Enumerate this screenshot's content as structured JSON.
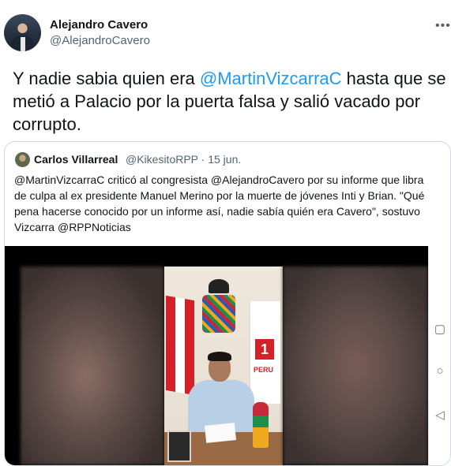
{
  "author": {
    "name": "Alejandro Cavero",
    "handle": "@AlejandroCavero"
  },
  "more_icon": "more-options-icon",
  "tweet": {
    "text_before": "Y nadie sabia quien era ",
    "mention": "@MartinVizcarraC",
    "text_after": " hasta que se metió a Palacio por la puerta falsa y salió vacado por corrupto."
  },
  "quote": {
    "name": "Carlos Villarreal",
    "handle_date": "@KikesitoRPP · 15 jun.",
    "text": "@MartinVizcarraC criticó al congresista @AlejandroCavero por su informe que libra de culpa al ex presidente Manuel Merino por la muerte de jóvenes Inti y Brian. \"Qué pena hacerse conocido por un informe así, nadie sabía quién era Cavero\", sostuvo Vizcarra @RPPNoticias"
  },
  "video": {
    "party_number": "1",
    "party_text": "PERU",
    "nav_icons": [
      "square-icon",
      "circle-icon",
      "back-triangle-icon"
    ]
  },
  "colors": {
    "link": "#1d9bf0",
    "secondary_text": "#536471",
    "border": "#cfd9de"
  }
}
